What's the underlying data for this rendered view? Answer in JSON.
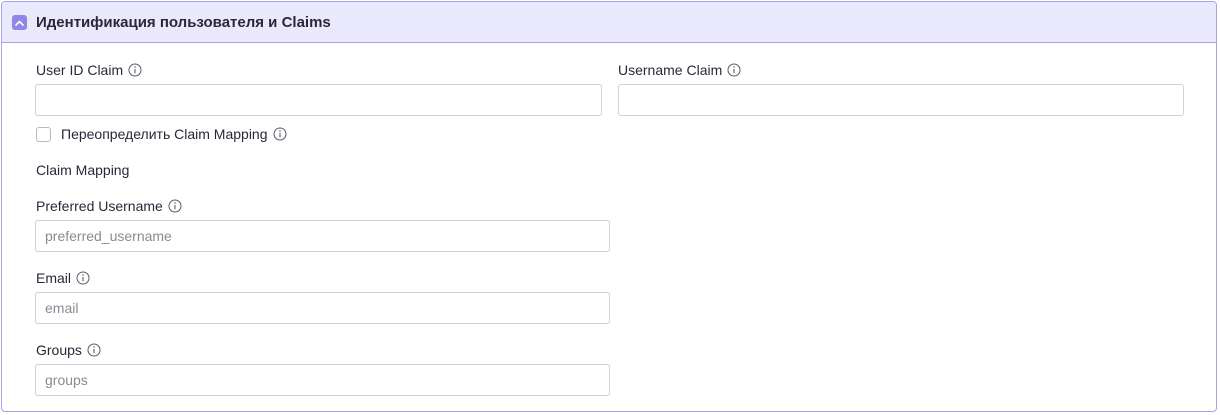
{
  "section": {
    "title": "Идентификация пользователя и Claims",
    "collapse_icon": "chevron-up-icon",
    "accent_color": "#8f86e8",
    "header_background": "#eae8fc"
  },
  "fields": {
    "user_id_claim": {
      "label": "User ID Claim",
      "value": "",
      "placeholder": ""
    },
    "username_claim": {
      "label": "Username Claim",
      "value": "",
      "placeholder": ""
    },
    "override_mapping": {
      "label": "Переопределить Claim Mapping",
      "checked": false
    },
    "claim_mapping_heading": "Claim Mapping",
    "preferred_username": {
      "label": "Preferred Username",
      "value": "",
      "placeholder": "preferred_username"
    },
    "email": {
      "label": "Email",
      "value": "",
      "placeholder": "email"
    },
    "groups": {
      "label": "Groups",
      "value": "",
      "placeholder": "groups"
    }
  },
  "icons": {
    "info": "info-icon"
  }
}
